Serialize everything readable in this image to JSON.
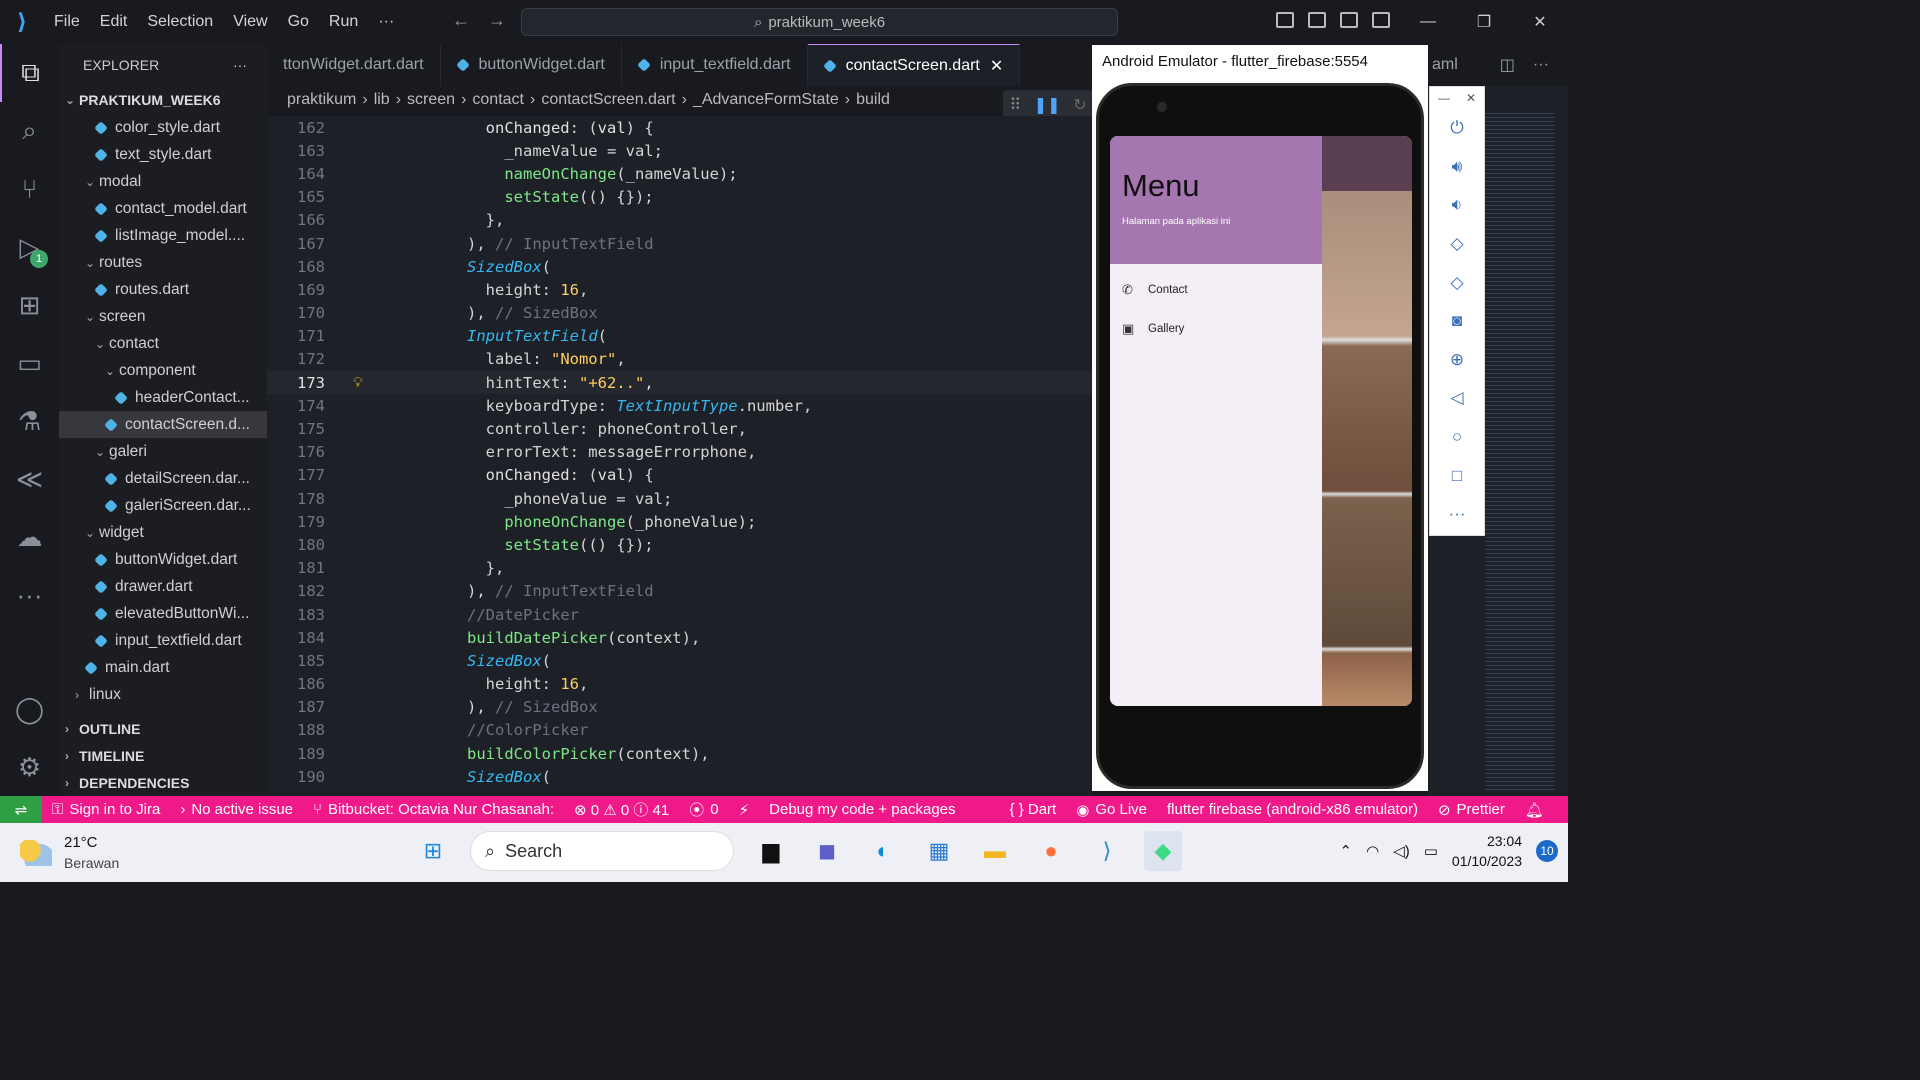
{
  "menu": [
    "File",
    "Edit",
    "Selection",
    "View",
    "Go",
    "Run",
    "···"
  ],
  "command_center": "praktikum_week6",
  "explorer": {
    "title": "EXPLORER",
    "more": "···",
    "project": "PRAKTIKUM_WEEK6",
    "items": [
      {
        "label": "color_style.dart",
        "indent": 3,
        "type": "file"
      },
      {
        "label": "text_style.dart",
        "indent": 3,
        "type": "file"
      },
      {
        "label": "modal",
        "indent": 2,
        "type": "folder"
      },
      {
        "label": "contact_model.dart",
        "indent": 3,
        "type": "file"
      },
      {
        "label": "listImage_model....",
        "indent": 3,
        "type": "file"
      },
      {
        "label": "routes",
        "indent": 2,
        "type": "folder"
      },
      {
        "label": "routes.dart",
        "indent": 3,
        "type": "file"
      },
      {
        "label": "screen",
        "indent": 2,
        "type": "folder"
      },
      {
        "label": "contact",
        "indent": 3,
        "type": "folder"
      },
      {
        "label": "component",
        "indent": 4,
        "type": "folder"
      },
      {
        "label": "headerContact...",
        "indent": 5,
        "type": "file"
      },
      {
        "label": "contactScreen.d...",
        "indent": 4,
        "type": "file",
        "selected": true
      },
      {
        "label": "galeri",
        "indent": 3,
        "type": "folder"
      },
      {
        "label": "detailScreen.dar...",
        "indent": 4,
        "type": "file"
      },
      {
        "label": "galeriScreen.dar...",
        "indent": 4,
        "type": "file"
      },
      {
        "label": "widget",
        "indent": 2,
        "type": "folder"
      },
      {
        "label": "buttonWidget.dart",
        "indent": 3,
        "type": "file"
      },
      {
        "label": "drawer.dart",
        "indent": 3,
        "type": "file"
      },
      {
        "label": "elevatedButtonWi...",
        "indent": 3,
        "type": "file"
      },
      {
        "label": "input_textfield.dart",
        "indent": 3,
        "type": "file"
      },
      {
        "label": "main.dart",
        "indent": 2,
        "type": "file"
      },
      {
        "label": "linux",
        "indent": 1,
        "type": "folder-closed"
      }
    ],
    "sections": [
      "OUTLINE",
      "TIMELINE",
      "DEPENDENCIES"
    ]
  },
  "debug_badge": "1",
  "tabs": [
    {
      "label": "ttonWidget.dart.dart",
      "active": false
    },
    {
      "label": "buttonWidget.dart",
      "active": false
    },
    {
      "label": "input_textfield.dart",
      "active": false
    },
    {
      "label": "contactScreen.dart",
      "active": true
    }
  ],
  "right_tab_fragment": "aml",
  "breadcrumb": [
    "praktikum",
    "lib",
    "screen",
    "contact",
    "contactScreen.dart",
    "_AdvanceFormState",
    "build"
  ],
  "code": [
    {
      "n": "162",
      "html": "        <span class='prop'>onChanged</span>: (<span class='prop'>val</span>) {"
    },
    {
      "n": "163",
      "html": "          _nameValue = val;"
    },
    {
      "n": "164",
      "html": "          <span class='fn'>nameOnChange</span>(_nameValue);"
    },
    {
      "n": "165",
      "html": "          <span class='fn'>setState</span>(() {});"
    },
    {
      "n": "166",
      "html": "        },"
    },
    {
      "n": "167",
      "html": "      ), <span class='cm'>// InputTextField</span>"
    },
    {
      "n": "168",
      "html": "      <span class='cls'>SizedBox</span>("
    },
    {
      "n": "169",
      "html": "        height: <span class='num'>16</span>,"
    },
    {
      "n": "170",
      "html": "      ), <span class='cm'>// SizedBox</span>"
    },
    {
      "n": "171",
      "html": "      <span class='cls'>InputTextField</span>("
    },
    {
      "n": "172",
      "html": "        label: <span class='str'>\"Nomor\"</span>,"
    },
    {
      "n": "173",
      "html": "        hintText: <span class='str'>\"+62..\"</span>,",
      "current": true
    },
    {
      "n": "174",
      "html": "        keyboardType: <span class='cls'>TextInputType</span>.number,"
    },
    {
      "n": "175",
      "html": "        controller: phoneController,"
    },
    {
      "n": "176",
      "html": "        errorText: messageErrorphone,"
    },
    {
      "n": "177",
      "html": "        <span class='prop'>onChanged</span>: (<span class='prop'>val</span>) {"
    },
    {
      "n": "178",
      "html": "          _phoneValue = val;"
    },
    {
      "n": "179",
      "html": "          <span class='fn'>phoneOnChange</span>(_phoneValue);"
    },
    {
      "n": "180",
      "html": "          <span class='fn'>setState</span>(() {});"
    },
    {
      "n": "181",
      "html": "        },"
    },
    {
      "n": "182",
      "html": "      ), <span class='cm'>// InputTextField</span>"
    },
    {
      "n": "183",
      "html": "      <span class='cm'>//DatePicker</span>"
    },
    {
      "n": "184",
      "html": "      <span class='fn'>buildDatePicker</span>(context),"
    },
    {
      "n": "185",
      "html": "      <span class='cls'>SizedBox</span>("
    },
    {
      "n": "186",
      "html": "        height: <span class='num'>16</span>,"
    },
    {
      "n": "187",
      "html": "      ), <span class='cm'>// SizedBox</span>"
    },
    {
      "n": "188",
      "html": "      <span class='cm'>//ColorPicker</span>"
    },
    {
      "n": "189",
      "html": "      <span class='fn'>buildColorPicker</span>(context),"
    },
    {
      "n": "190",
      "html": "      <span class='cls'>SizedBox</span>("
    }
  ],
  "emulator": {
    "title": "Android Emulator - flutter_firebase:5554",
    "drawer_title": "Menu",
    "drawer_subtitle": "Halaman pada aplikasi ini",
    "items": [
      {
        "label": "Contact",
        "icon": "phone-icon"
      },
      {
        "label": "Gallery",
        "icon": "image-icon"
      }
    ],
    "controls": [
      "power-icon",
      "volume-up-icon",
      "volume-down-icon",
      "rotate-left-icon",
      "rotate-right-icon",
      "camera-icon",
      "zoom-icon",
      "back-icon",
      "home-icon",
      "overview-icon",
      "more-icon"
    ]
  },
  "statusbar": {
    "jira": "Sign in to Jira",
    "issue": "No active issue",
    "bitbucket": "Bitbucket: Octavia Nur Chasanah:",
    "problems": "⊗ 0 ⚠ 0 ⓘ 41",
    "ports": "0",
    "debug": "Debug my code + packages",
    "lang": "{ } Dart",
    "golive": "Go Live",
    "device": "flutter firebase (android-x86 emulator)",
    "prettier": "Prettier"
  },
  "taskbar": {
    "temp": "21°C",
    "weather": "Berawan",
    "search": "Search",
    "time": "23:04",
    "date": "01/10/2023",
    "notifications": "10"
  }
}
